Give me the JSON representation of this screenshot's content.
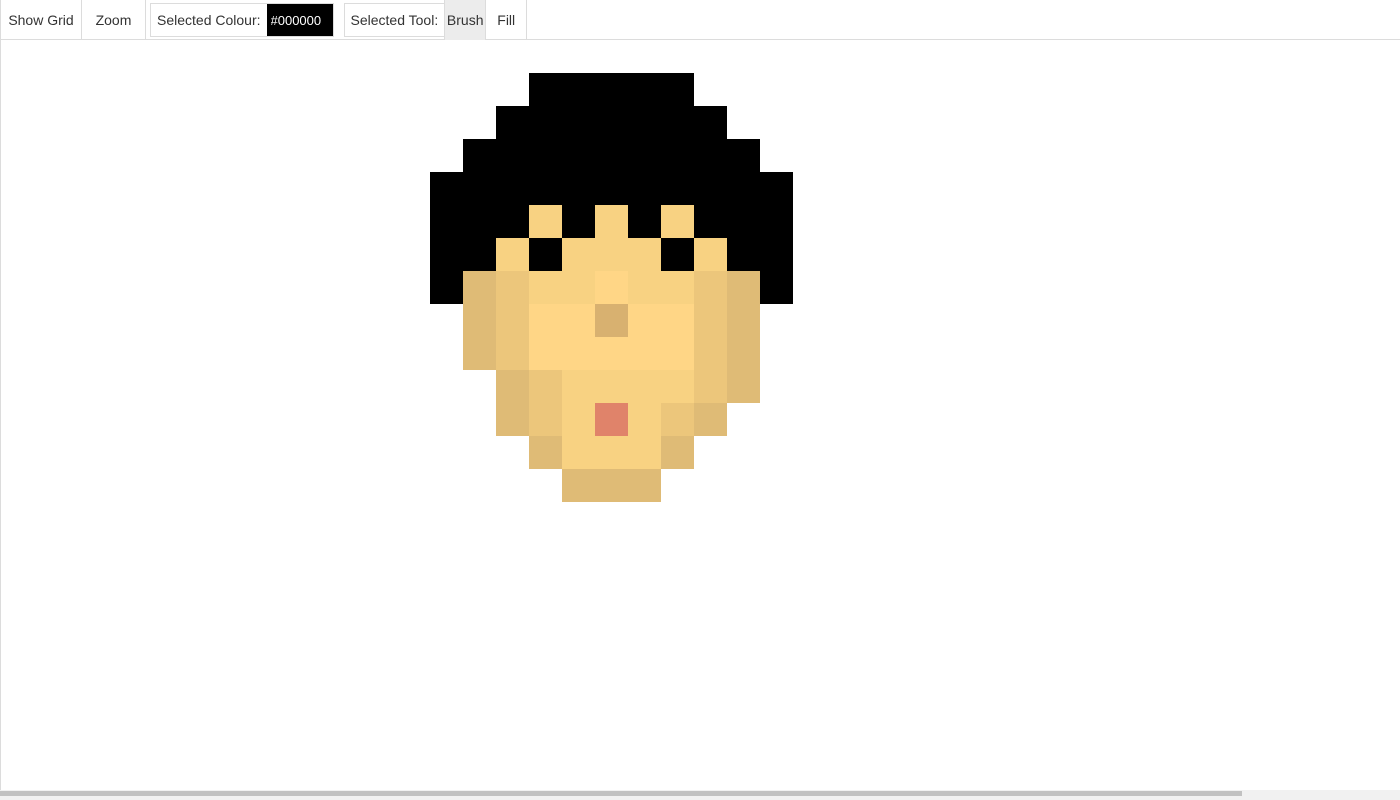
{
  "toolbar": {
    "show_grid_label": "Show Grid",
    "zoom_label": "Zoom",
    "selected_colour_label": "Selected Colour:",
    "selected_colour_value": "#000000",
    "selected_tool_label": "Selected Tool:",
    "tools": [
      "Brush",
      "Fill"
    ],
    "active_tool": "Brush"
  },
  "canvas": {
    "palette": {
      "H": "#000000",
      "A": "#f8d282",
      "B": "#ffd686",
      "C": "#dfbb76",
      "D": "#ecc67b",
      "E": "#d8b170",
      "F": "#e0836a"
    },
    "pixels": [
      "...HHHHH...",
      "..HHHHHHH..",
      ".HHHHHHHHH.",
      "HHHHHHHHHHH",
      "HHHAHAHAHHH",
      "HHAHAAAHAHH",
      "HCDAABAADCH",
      ".CDBBEBBDC.",
      ".CDBBBBBDC.",
      "..CDAAAADC.",
      "..CDAFADC..",
      "...CAAAC...",
      "....CCC...."
    ]
  }
}
